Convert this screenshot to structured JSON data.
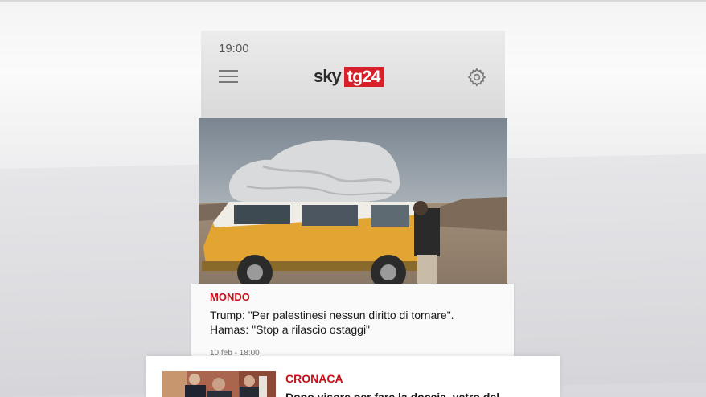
{
  "status_bar": {
    "time": "19:00"
  },
  "header": {
    "logo_sky": "sky",
    "logo_tg": "tg24",
    "menu_icon": "hamburger-menu-icon",
    "settings_icon": "gear-icon"
  },
  "articles": [
    {
      "category": "MONDO",
      "headline_line1": "Trump: \"Per palestinesi nessun diritto di tornare\".",
      "headline_line2": "Hamas: \"Stop a rilascio ostaggi\"",
      "date": "10 feb - 18:00"
    },
    {
      "category": "CRONACA",
      "headline": "Dopo visore per fare la doccia, vetro del"
    }
  ],
  "colors": {
    "accent": "#c8101a",
    "logo_red": "#d8202a"
  }
}
